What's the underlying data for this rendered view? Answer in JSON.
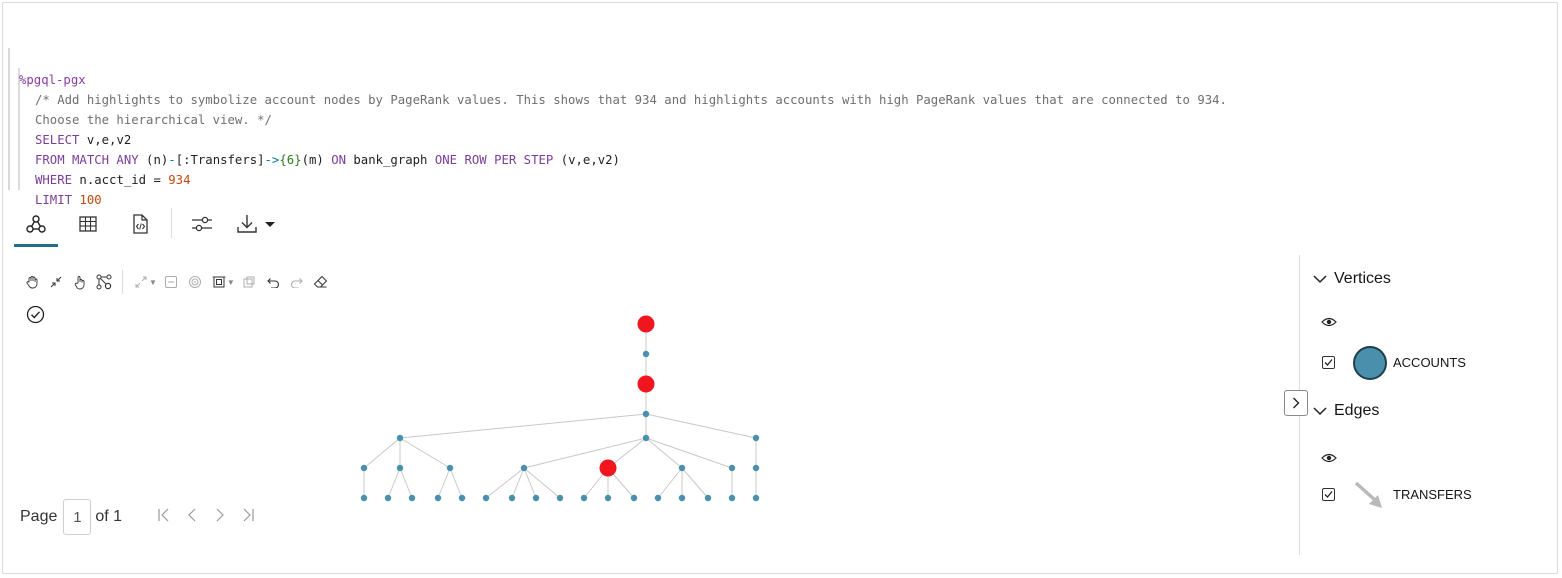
{
  "code": {
    "magic": "%pgql-pgx",
    "comment_line1": "/* Add highlights to symbolize account nodes by PageRank values. This shows that 934 and highlights accounts with high PageRank values that are connected to 934.",
    "comment_line2": "Choose the hierarchical view. */",
    "select_kw": "SELECT",
    "select_rest": " v,e,v2",
    "from_kw": "FROM MATCH ANY",
    "from_n": " (n)",
    "from_dash": "-",
    "from_label": "[:Transfers]",
    "from_arrow": "->",
    "from_quant": "{6}",
    "from_m": "(m) ",
    "on_kw": "ON",
    "graph_name": " bank_graph ",
    "one_row_kw": "ONE ROW PER STEP",
    "step_vars": " (v,e,v2)",
    "where_kw": "WHERE",
    "where_rest": " n.acct_id = ",
    "where_val": "934",
    "limit_kw": "LIMIT",
    "limit_val": "100"
  },
  "tabs": [
    {
      "icon": "graph-view-icon",
      "active": true
    },
    {
      "icon": "table-view-icon",
      "active": false
    },
    {
      "icon": "json-view-icon",
      "active": false
    },
    {
      "icon": "settings-sliders-icon",
      "active": false
    },
    {
      "icon": "download-icon",
      "active": false
    }
  ],
  "pager": {
    "page_label": "Page",
    "page_value": "1",
    "of_label": "of 1"
  },
  "legend": {
    "vertices_title": "Vertices",
    "vertex_label": "ACCOUNTS",
    "vertex_color": "#4a8fab",
    "edges_title": "Edges",
    "edge_label": "TRANSFERS"
  },
  "colors": {
    "highlight": "#f0151f",
    "node": "#4a8fab",
    "edge": "#c8c8c8"
  }
}
